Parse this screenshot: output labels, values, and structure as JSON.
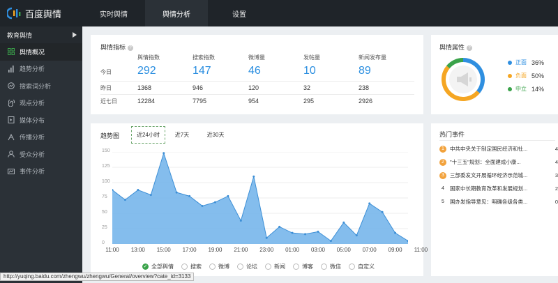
{
  "app": {
    "name": "百度舆情"
  },
  "nav": {
    "tabs": [
      {
        "label": "实时舆情"
      },
      {
        "label": "舆情分析"
      },
      {
        "label": "设置"
      }
    ]
  },
  "sidebar": {
    "header": "教育舆情",
    "items": [
      {
        "label": "舆情概况",
        "icon": "grid-icon"
      },
      {
        "label": "趋势分析",
        "icon": "bar-chart-icon"
      },
      {
        "label": "搜索词分析",
        "icon": "search-trend-icon"
      },
      {
        "label": "观点分析",
        "icon": "spiral-icon"
      },
      {
        "label": "媒体分布",
        "icon": "media-icon"
      },
      {
        "label": "传播分析",
        "icon": "spread-icon"
      },
      {
        "label": "受众分析",
        "icon": "user-icon"
      },
      {
        "label": "事件分析",
        "icon": "event-icon"
      }
    ]
  },
  "metrics": {
    "title": "舆情指标",
    "columns": [
      "舆情指数",
      "搜索指数",
      "微博量",
      "发帖量",
      "新闻发布量"
    ],
    "rows": [
      {
        "label": "今日",
        "values": [
          "292",
          "147",
          "46",
          "10",
          "89"
        ]
      },
      {
        "label": "昨日",
        "values": [
          "1368",
          "946",
          "120",
          "32",
          "238"
        ]
      },
      {
        "label": "近七日",
        "values": [
          "12284",
          "7795",
          "954",
          "295",
          "2926"
        ]
      }
    ]
  },
  "attribute": {
    "title": "舆情属性",
    "items": [
      {
        "label": "正面",
        "pct": "36%",
        "color": "#2f8fe0",
        "value": 36
      },
      {
        "label": "负面",
        "pct": "50%",
        "color": "#f5a623",
        "value": 50
      },
      {
        "label": "中立",
        "pct": "14%",
        "color": "#3aa34a",
        "value": 14
      }
    ]
  },
  "trend": {
    "title": "趋势图",
    "tabs": [
      "近24小时",
      "近7天",
      "近30天"
    ],
    "filters": [
      "全部舆情",
      "搜索",
      "微博",
      "论坛",
      "新闻",
      "博客",
      "微信",
      "自定义"
    ]
  },
  "chart_data": {
    "type": "area",
    "x": [
      "11:00",
      "12:00",
      "13:00",
      "14:00",
      "15:00",
      "16:00",
      "17:00",
      "18:00",
      "19:00",
      "20:00",
      "21:00",
      "22:00",
      "23:00",
      "00:00",
      "01:00",
      "02:00",
      "03:00",
      "04:00",
      "05:00",
      "06:00",
      "07:00",
      "08:00",
      "09:00",
      "10:00",
      "11:00"
    ],
    "xticks": [
      "11:00",
      "13:00",
      "15:00",
      "17:00",
      "19:00",
      "21:00",
      "23:00",
      "01:00",
      "03:00",
      "05:00",
      "07:00",
      "09:00",
      "11:00"
    ],
    "values": [
      88,
      72,
      88,
      80,
      148,
      84,
      78,
      62,
      68,
      78,
      38,
      110,
      10,
      28,
      18,
      16,
      20,
      5,
      35,
      14,
      66,
      52,
      18,
      5
    ],
    "ylim": [
      0,
      150
    ],
    "yticks": [
      0,
      25,
      50,
      75,
      100,
      125,
      150
    ],
    "color": "#6fb2ea"
  },
  "hot": {
    "title": "热门事件",
    "items": [
      {
        "rank": "1",
        "text": "中共中央关于制定国民经济和社...",
        "count": "4"
      },
      {
        "rank": "2",
        "text": "\"十三五\"规划：全面建成小康...",
        "count": "4"
      },
      {
        "rank": "3",
        "text": "三部委发文开展循环经济示范城...",
        "count": "3"
      },
      {
        "rank": "4",
        "text": "国家中长期教育改革和发展规划...",
        "count": "2"
      },
      {
        "rank": "5",
        "text": "国办发指导意见：明确各级各类...",
        "count": "0"
      }
    ]
  },
  "status": {
    "url": "http://yuqing.baidu.com/zhengwu/zhengwu/General/overview?cate_id=3133"
  }
}
